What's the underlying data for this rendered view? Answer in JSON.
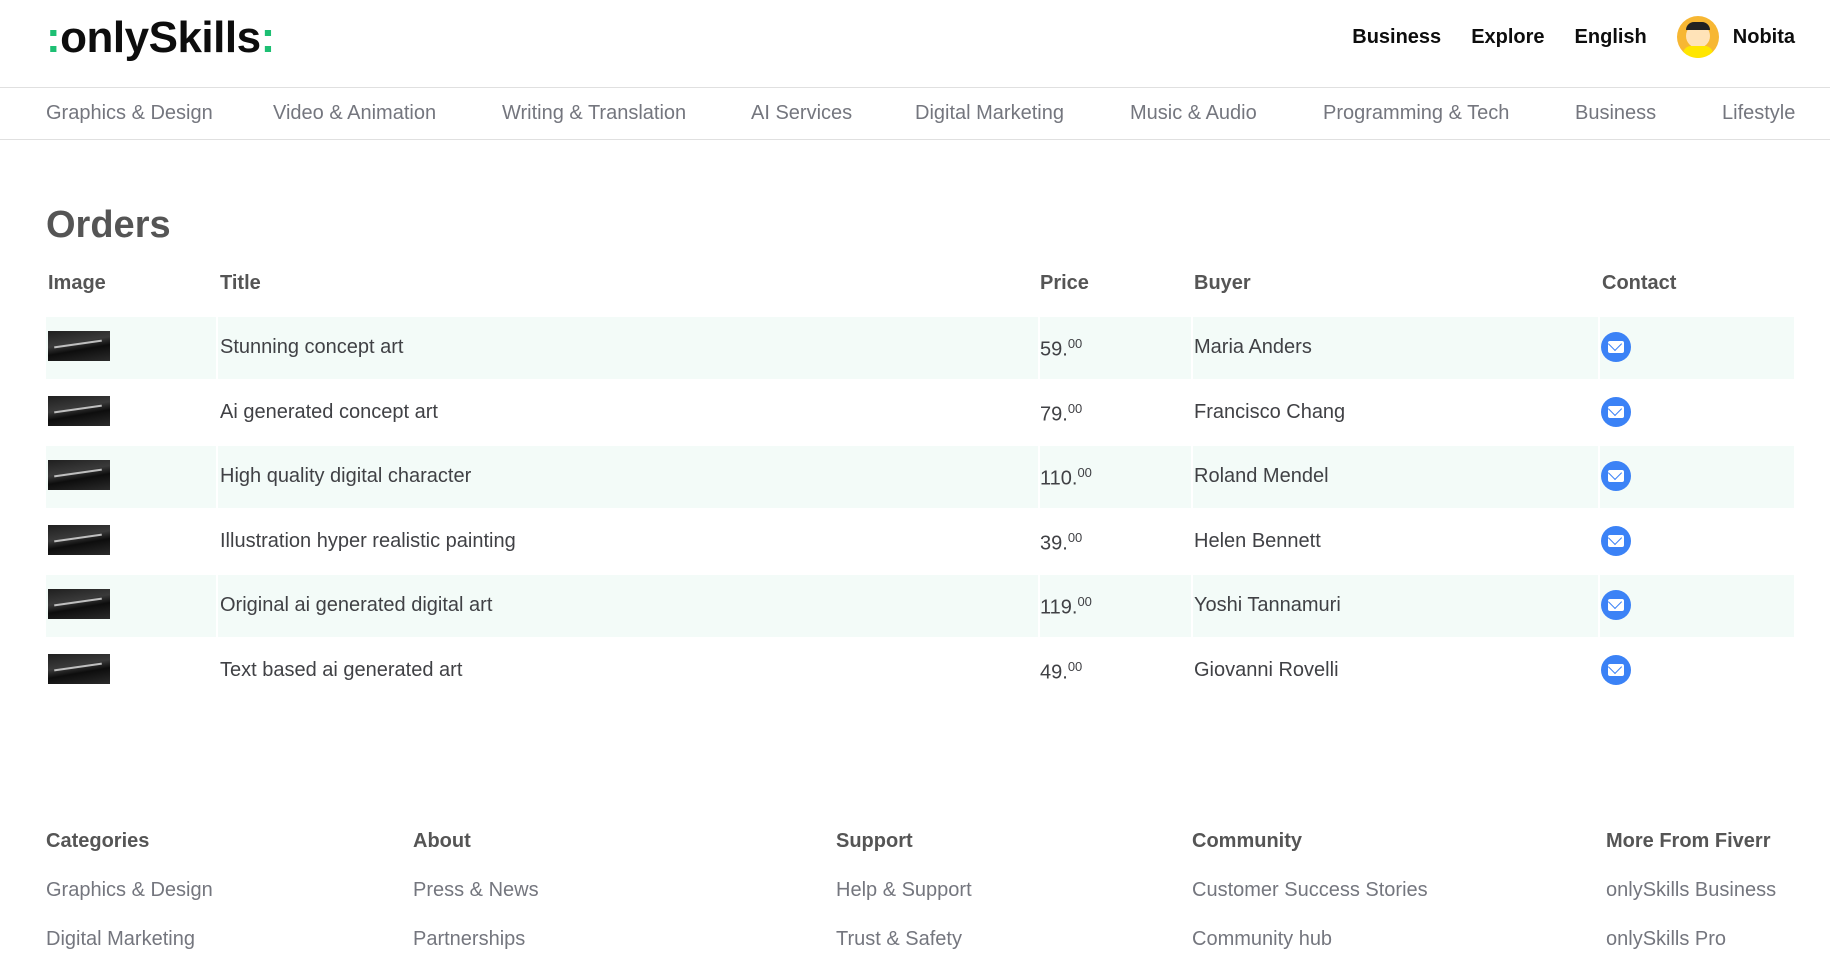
{
  "header": {
    "logo_prefix": ":",
    "logo_text": "onlySkills",
    "logo_suffix": ":",
    "nav": [
      "Business",
      "Explore",
      "English"
    ],
    "user_name": "Nobita"
  },
  "categories": [
    "Graphics & Design",
    "Video & Animation",
    "Writing & Translation",
    "AI Services",
    "Digital Marketing",
    "Music & Audio",
    "Programming & Tech",
    "Business",
    "Lifestyle"
  ],
  "orders": {
    "title": "Orders",
    "columns": [
      "Image",
      "Title",
      "Price",
      "Buyer",
      "Contact"
    ],
    "rows": [
      {
        "title": "Stunning concept art",
        "price": "59.",
        "cents": "00",
        "buyer": "Maria Anders"
      },
      {
        "title": "Ai generated concept art",
        "price": "79.",
        "cents": "00",
        "buyer": "Francisco Chang"
      },
      {
        "title": "High quality digital character",
        "price": "110.",
        "cents": "00",
        "buyer": "Roland Mendel"
      },
      {
        "title": "Illustration hyper realistic painting",
        "price": "39.",
        "cents": "00",
        "buyer": "Helen Bennett"
      },
      {
        "title": "Original ai generated digital art",
        "price": "119.",
        "cents": "00",
        "buyer": "Yoshi Tannamuri"
      },
      {
        "title": "Text based ai generated art",
        "price": "49.",
        "cents": "00",
        "buyer": "Giovanni Rovelli"
      }
    ]
  },
  "footer": {
    "columns": [
      {
        "heading": "Categories",
        "links": [
          "Graphics & Design",
          "Digital Marketing"
        ]
      },
      {
        "heading": "About",
        "links": [
          "Press & News",
          "Partnerships"
        ]
      },
      {
        "heading": "Support",
        "links": [
          "Help & Support",
          "Trust & Safety"
        ]
      },
      {
        "heading": "Community",
        "links": [
          "Customer Success Stories",
          "Community hub"
        ]
      },
      {
        "heading": "More From Fiverr",
        "links": [
          "onlySkills Business",
          "onlySkills Pro"
        ]
      }
    ]
  },
  "colors": {
    "brand_green": "#1dbf73",
    "row_alt": "#f3fbf8",
    "mail_blue": "#3b82f6"
  }
}
